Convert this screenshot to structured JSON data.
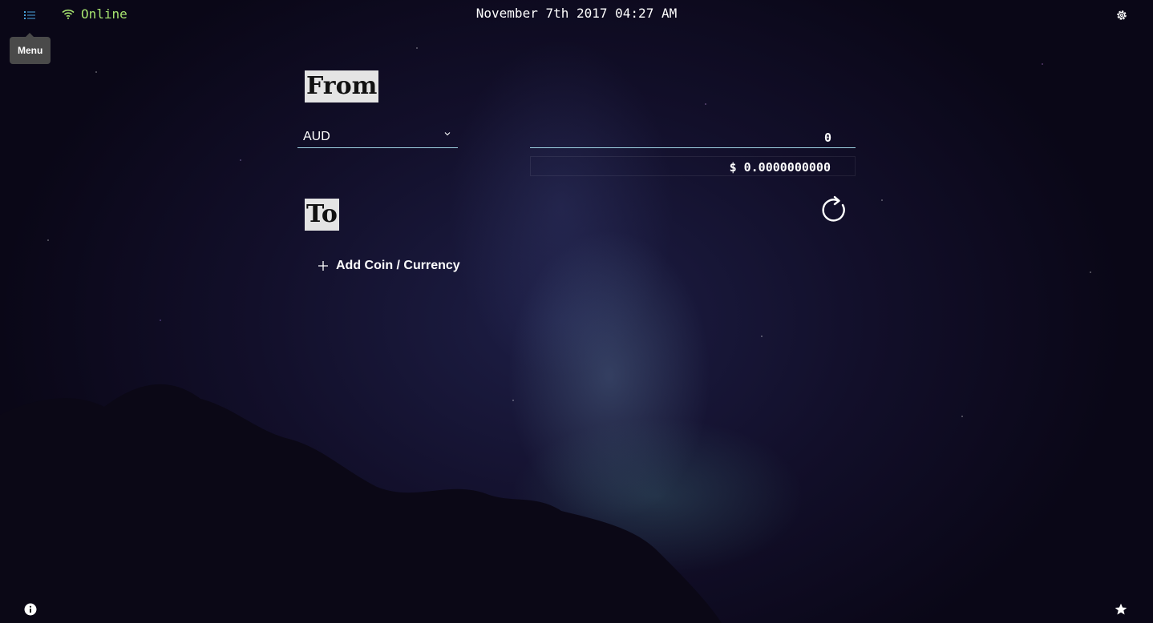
{
  "header": {
    "menu_icon": "list-icon",
    "menu_tooltip": "Menu",
    "status_icon": "wifi-icon",
    "status_text": "Online",
    "status_color": "#a6e36f",
    "datetime": "November 7th 2017 04:27 AM",
    "settings_icon": "gear-icon"
  },
  "from": {
    "title": "From",
    "currency": "AUD",
    "amount": "0",
    "converted": "$ 0.0000000000"
  },
  "to": {
    "title": "To",
    "refresh_icon": "refresh-icon",
    "add_label": "Add Coin / Currency"
  },
  "footer": {
    "info_icon": "info-icon",
    "star_icon": "star-icon"
  },
  "colors": {
    "accent": "#4aa3df",
    "underline": "#9fd3e3",
    "title_bg": "#e4e4e4"
  }
}
